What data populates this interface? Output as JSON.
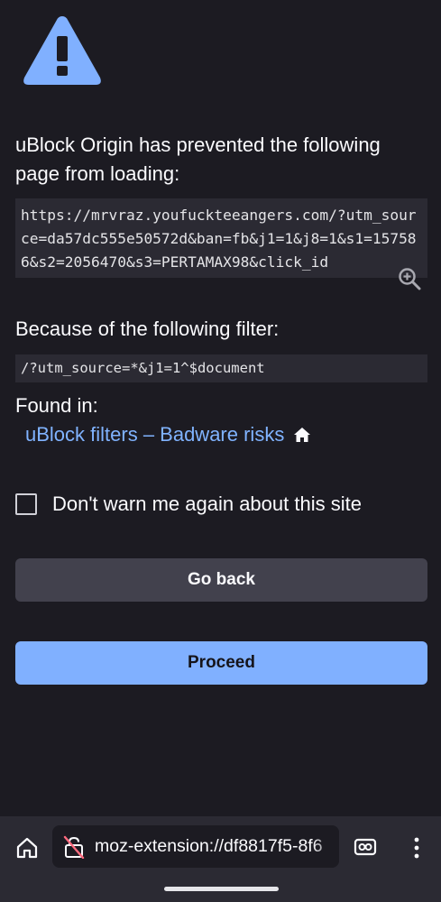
{
  "colors": {
    "background": "#1c1b22",
    "code_background": "#2b2a33",
    "accent": "#80b0ff",
    "link": "#80b3ff",
    "secondary_button": "#42414d"
  },
  "icons": {
    "warning": "warning-triangle-icon",
    "zoom": "zoom-in-icon",
    "filter_home": "home-icon",
    "toolbar_home": "home-icon",
    "site_info": "broken-lock-icon",
    "tabs": "tabs-icon",
    "menu": "kebab-menu-icon"
  },
  "page": {
    "headline": "uBlock Origin has prevented the following page from loading:",
    "blocked_url": "https://mrvraz.youfuckteeangers.com/?utm_source=da57dc555e50572d&ban=fb&j1=1&j8=1&s1=157586&s2=2056470&s3=PERTAMAX98&click_id",
    "filter_heading": "Because of the following filter:",
    "filter_rule": "/?utm_source=*&j1=1^$document",
    "found_in_label": "Found in:",
    "filter_list_name": "uBlock filters – Badware risks",
    "dont_warn_label": "Don't warn me again about this site",
    "dont_warn_checked": false,
    "go_back_label": "Go back",
    "proceed_label": "Proceed"
  },
  "toolbar": {
    "url": "moz-extension://df8817f5-8f6"
  }
}
